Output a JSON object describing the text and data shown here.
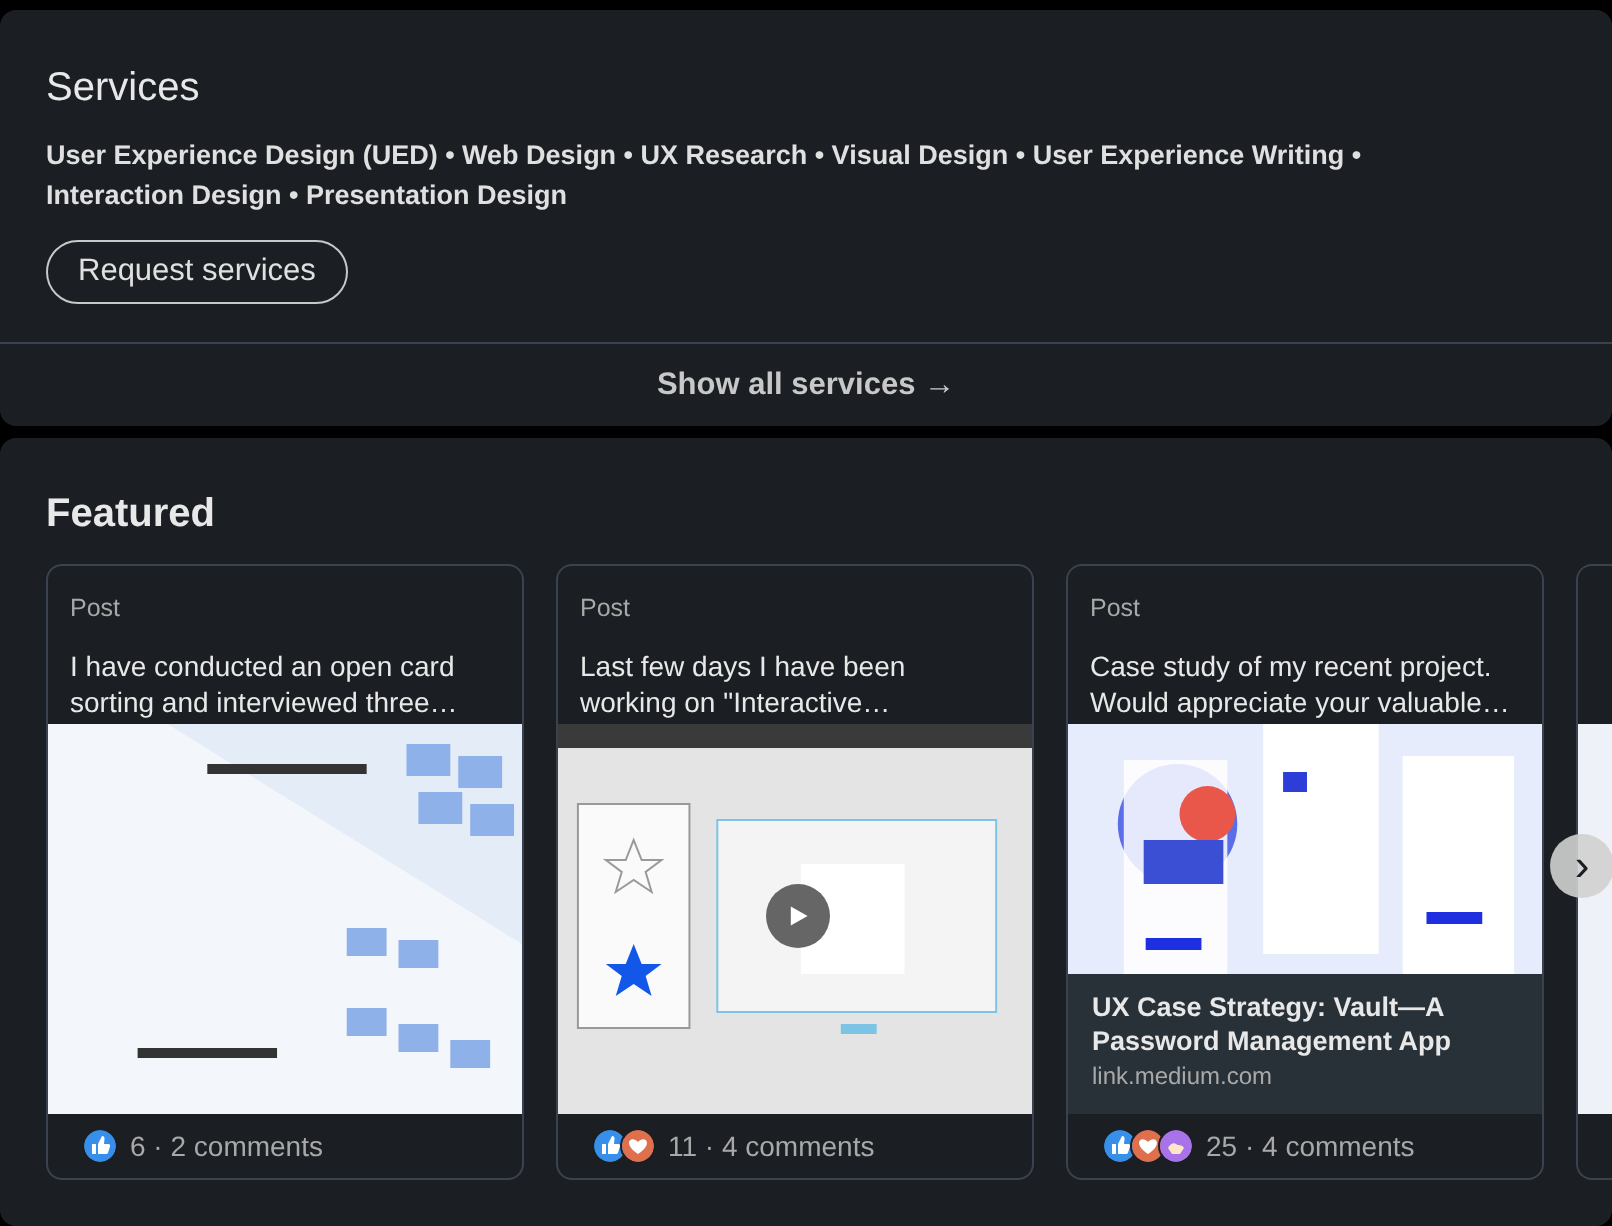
{
  "services": {
    "title": "Services",
    "list": "User Experience Design (UED) • Web Design • UX Research • Visual Design • User Experience Writing • Interaction Design • Presentation Design",
    "request_button": "Request services",
    "show_all": "Show all services →"
  },
  "featured": {
    "title": "Featured",
    "items": [
      {
        "type": "Post",
        "lines": [
          "I have conducted an open card",
          "sorting and interviewed three…"
        ],
        "kind": "picture",
        "reactions": [
          {
            "kind": "like"
          }
        ],
        "stats": "6 · 2 comments"
      },
      {
        "type": "Post",
        "lines": [
          "Last few days I have been",
          "working on \"Interactive…"
        ],
        "kind": "video",
        "reactions": [
          {
            "kind": "like"
          },
          {
            "kind": "love"
          }
        ],
        "stats": "11 · 4 comments"
      },
      {
        "type": "Post",
        "lines": [
          "Case study of my recent project.",
          "Would appreciate your valuable…"
        ],
        "kind": "article",
        "link_title": "UX Case Strategy: Vault—A Password Management App",
        "link_domain": "link.medium.com",
        "reactions": [
          {
            "kind": "like"
          },
          {
            "kind": "love"
          },
          {
            "kind": "support"
          }
        ],
        "stats": "25 · 4 comments"
      },
      {
        "kind": "partial"
      }
    ],
    "next_button": "›"
  }
}
